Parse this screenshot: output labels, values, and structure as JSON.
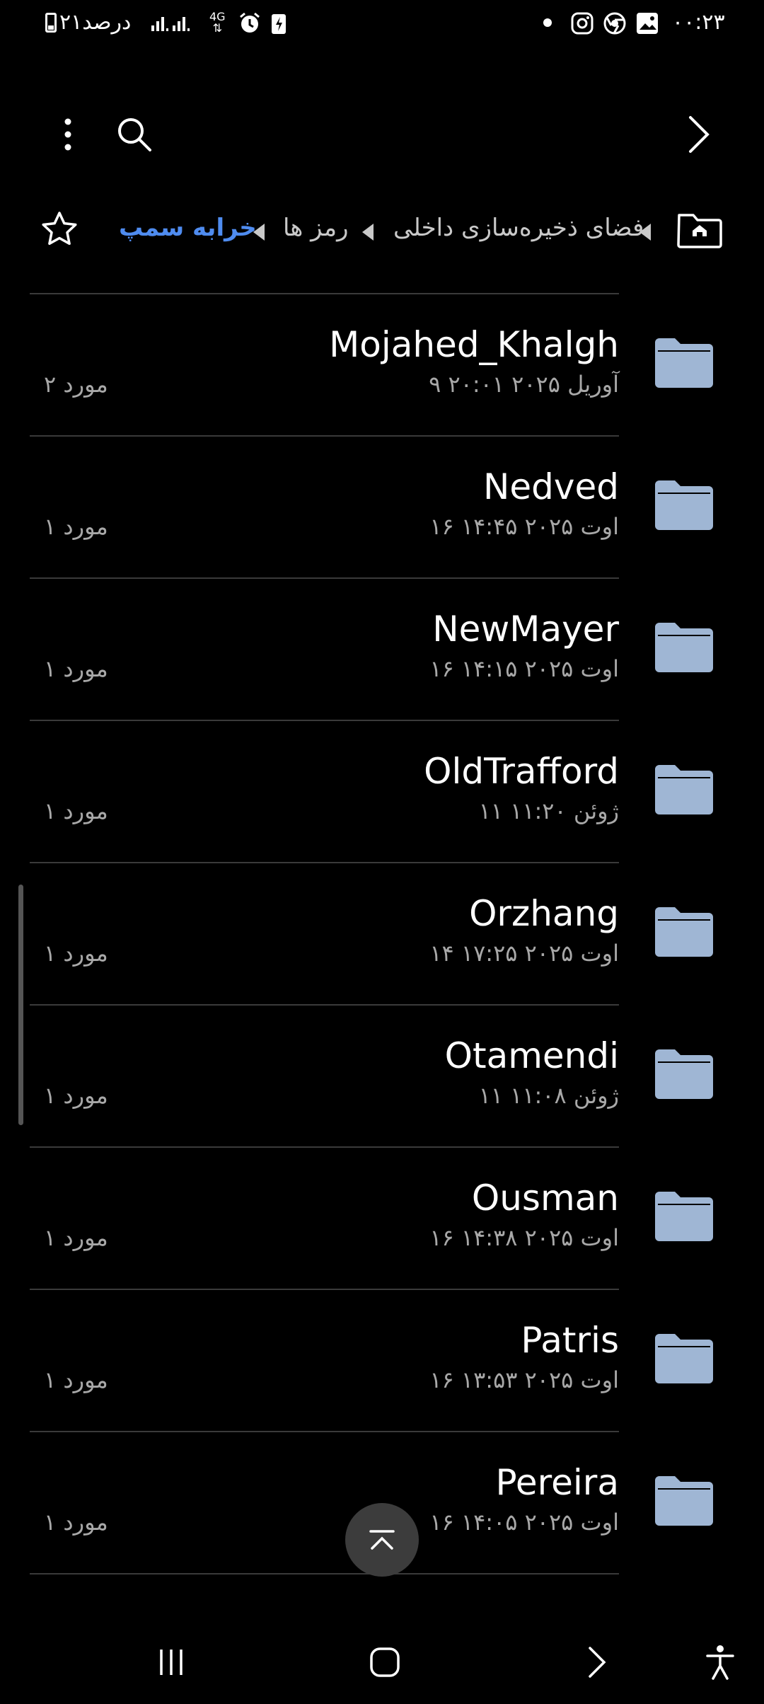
{
  "status_bar": {
    "time": "۰۰:۲۳",
    "battery": "۲۱درصد",
    "network": "4G"
  },
  "breadcrumb": {
    "items": [
      "فضای ذخیره‌سازی داخلی",
      "رمز ها",
      "خرابه سمپ"
    ]
  },
  "files": [
    {
      "name": "Mojahed_Khalgh",
      "date": "۹ آوریل ۲۰۲۵ ۲۰:۰۱",
      "count": "۲ مورد"
    },
    {
      "name": "Nedved",
      "date": "۱۶ اوت ۲۰۲۵ ۱۴:۴۵",
      "count": "۱ مورد"
    },
    {
      "name": "NewMayer",
      "date": "۱۶ اوت ۲۰۲۵ ۱۴:۱۵",
      "count": "۱ مورد"
    },
    {
      "name": "OldTrafford",
      "date": "۱۱ ژوئن ۱۱:۲۰",
      "count": "۱ مورد"
    },
    {
      "name": "Orzhang",
      "date": "۱۴ اوت ۲۰۲۵ ۱۷:۲۵",
      "count": "۱ مورد"
    },
    {
      "name": "Otamendi",
      "date": "۱۱ ژوئن ۱۱:۰۸",
      "count": "۱ مورد"
    },
    {
      "name": "Ousman",
      "date": "۱۶ اوت ۲۰۲۵ ۱۴:۳۸",
      "count": "۱ مورد"
    },
    {
      "name": "Patris",
      "date": "۱۶ اوت ۲۰۲۵ ۱۳:۵۳",
      "count": "۱ مورد"
    },
    {
      "name": "Pereira",
      "date": "۱۶ اوت ۲۰۲۵ ۱۴:۰۵",
      "count": "۱ مورد"
    }
  ],
  "colors": {
    "background": "#000000",
    "accent": "#4f8cf0",
    "folder": "#9fb6d4",
    "secondary_text": "#a8a8a8"
  },
  "icons": {
    "toolbar": [
      "more-vert-icon",
      "search-icon",
      "forward-arrow-icon"
    ],
    "breadcrumb": [
      "star-icon",
      "home-folder-icon"
    ],
    "fab": "scroll-to-top-icon",
    "nav": [
      "recents-icon",
      "home-icon",
      "back-icon",
      "accessibility-icon"
    ]
  }
}
